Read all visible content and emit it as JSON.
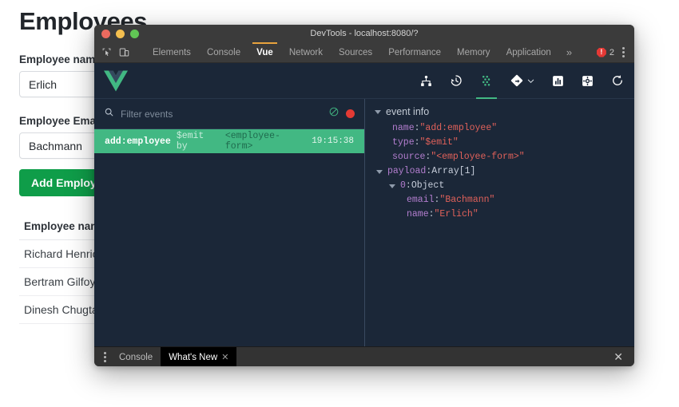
{
  "page": {
    "title": "Employees",
    "name_label": "Employee name",
    "name_value": "Erlich",
    "name_placeholder": "",
    "email_label": "Employee Email",
    "email_value": "Bachmann",
    "email_placeholder": "",
    "add_button": "Add Employee",
    "table": {
      "headers": [
        "Employee name"
      ],
      "rows": [
        "Richard Henricks",
        "Bertram Gilfoyle",
        "Dinesh Chugtai"
      ]
    }
  },
  "devtools": {
    "window_title": "DevTools - localhost:8080/?",
    "tabs": [
      {
        "label": "Elements",
        "active": false
      },
      {
        "label": "Console",
        "active": false
      },
      {
        "label": "Vue",
        "active": true
      },
      {
        "label": "Network",
        "active": false
      },
      {
        "label": "Sources",
        "active": false
      },
      {
        "label": "Performance",
        "active": false
      },
      {
        "label": "Memory",
        "active": false
      },
      {
        "label": "Application",
        "active": false
      }
    ],
    "more_tabs": "»",
    "error_count": "2",
    "inspect_icon": "inspect-element-icon",
    "device_icon": "device-toolbar-icon",
    "menu_icon": "kebab-menu-icon"
  },
  "vue": {
    "logo": "vue-logo",
    "toolbar": [
      {
        "name": "components-tree-icon",
        "active": false
      },
      {
        "name": "timeline-history-icon",
        "active": false
      },
      {
        "name": "events-icon",
        "active": true
      },
      {
        "name": "vuex-icon",
        "active": false,
        "chevron": true
      },
      {
        "name": "performance-chart-icon",
        "active": false
      },
      {
        "name": "settings-gear-icon",
        "active": false
      },
      {
        "name": "refresh-icon",
        "active": false
      }
    ],
    "filter": {
      "search_icon": "search-icon",
      "placeholder": "Filter events",
      "value": "",
      "clear_icon": "no-entry-clear-icon",
      "record_icon": "record-dot-icon"
    },
    "events": [
      {
        "name": "add:employee",
        "type": "$emit by",
        "source": "<employee-form>",
        "time": "19:15:38",
        "selected": true
      }
    ],
    "info": {
      "header": "event info",
      "rows": [
        {
          "indent": 1,
          "key": "name",
          "sep": ": ",
          "value": "\"add:employee\"",
          "value_kind": "string",
          "caret": false
        },
        {
          "indent": 1,
          "key": "type",
          "sep": ": ",
          "value": "\"$emit\"",
          "value_kind": "string",
          "caret": false
        },
        {
          "indent": 1,
          "key": "source",
          "sep": ": ",
          "value": "\"<employee-form>\"",
          "value_kind": "string",
          "caret": false
        },
        {
          "indent": 0,
          "key": "payload",
          "sep": ": ",
          "value": "Array[1]",
          "value_kind": "plain",
          "caret": true
        },
        {
          "indent": 2,
          "key": "0",
          "sep": ": ",
          "value": "Object",
          "value_kind": "plain",
          "caret": true
        },
        {
          "indent": 3,
          "key": "email",
          "sep": ": ",
          "value": "\"Bachmann\"",
          "value_kind": "string",
          "caret": false
        },
        {
          "indent": 3,
          "key": "name",
          "sep": ": ",
          "value": "\"Erlich\"",
          "value_kind": "string",
          "caret": false
        }
      ]
    }
  },
  "drawer": {
    "menu_icon": "kebab-menu-icon",
    "tabs": [
      {
        "label": "Console",
        "active": false,
        "closable": false
      },
      {
        "label": "What's New",
        "active": true,
        "closable": true
      }
    ],
    "close_label": "✕"
  },
  "colors": {
    "vue_green": "#42b883",
    "panel_bg": "#1b2738",
    "accent_orange": "#e8a33d",
    "error_red": "#e53935",
    "add_button_green": "#0f9d49"
  }
}
